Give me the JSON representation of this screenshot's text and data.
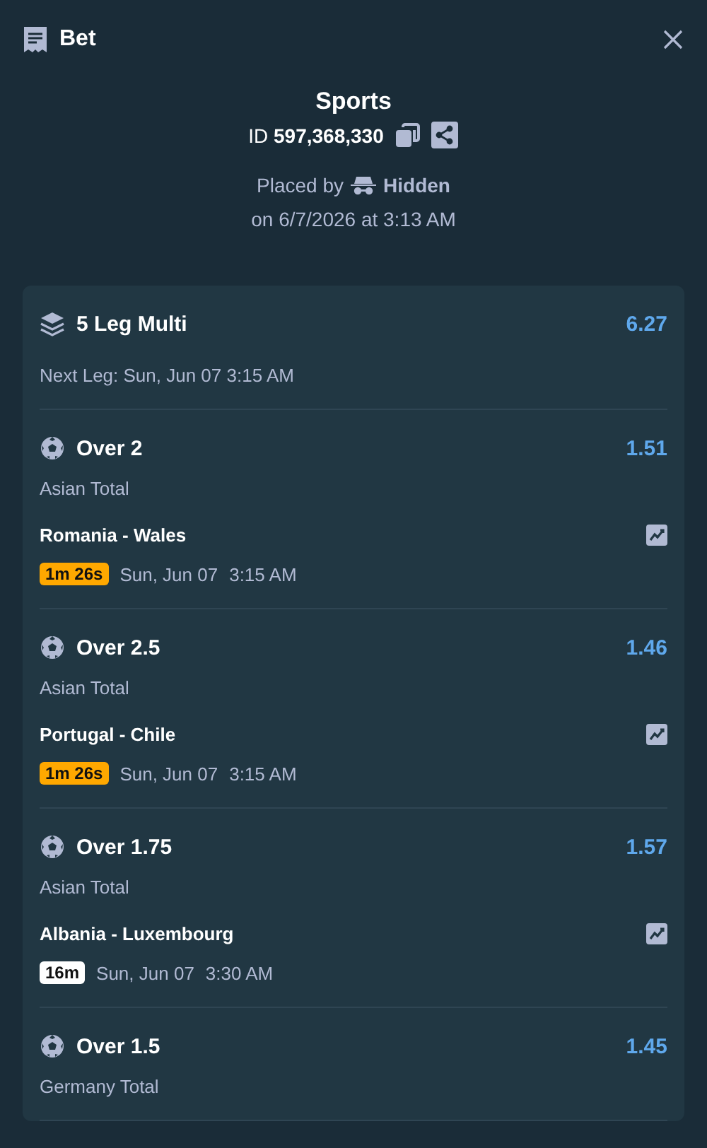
{
  "header": {
    "title": "Bet"
  },
  "summary": {
    "title": "Sports",
    "id_label": "ID",
    "id_value": "597,368,330",
    "placed_by_label": "Placed by",
    "user": "Hidden",
    "placed_on": "on 6/7/2026 at 3:13 AM"
  },
  "multi": {
    "title": "5 Leg Multi",
    "odds": "6.27",
    "next_leg": "Next Leg: Sun, Jun 07 3:15 AM"
  },
  "legs": [
    {
      "selection": "Over 2",
      "odds": "1.51",
      "market": "Asian Total",
      "match": "Romania - Wales",
      "countdown": "1m 26s",
      "color": "#ffa800",
      "date": "Sun, Jun 07",
      "time": "3:15 AM"
    },
    {
      "selection": "Over 2.5",
      "odds": "1.46",
      "market": "Asian Total",
      "match": "Portugal - Chile",
      "countdown": "1m 26s",
      "color": "#ffa800",
      "date": "Sun, Jun 07",
      "time": "3:15 AM"
    },
    {
      "selection": "Over 1.75",
      "odds": "1.57",
      "market": "Asian Total",
      "match": "Albania - Luxembourg",
      "countdown": "16m",
      "color": "#ffffff",
      "date": "Sun, Jun 07",
      "time": "3:30 AM"
    },
    {
      "selection": "Over 1.5",
      "odds": "1.45",
      "market": "Germany Total"
    }
  ]
}
